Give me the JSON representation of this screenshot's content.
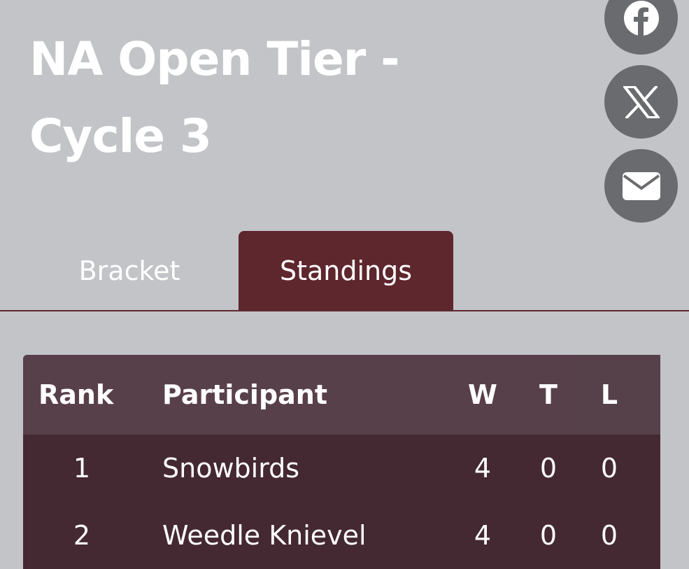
{
  "page": {
    "title": "NA Open Tier - Cycle 3"
  },
  "share": {
    "icons": [
      "facebook-icon",
      "x-icon",
      "email-icon"
    ]
  },
  "tabs": [
    {
      "label": "Bracket",
      "active": false
    },
    {
      "label": "Standings",
      "active": true
    }
  ],
  "standings": {
    "headers": {
      "rank": "Rank",
      "participant": "Participant",
      "w": "W",
      "t": "T",
      "l": "L"
    },
    "rows": [
      {
        "rank": "1",
        "participant": "Snowbirds",
        "w": "4",
        "t": "0",
        "l": "0"
      },
      {
        "rank": "2",
        "participant": "Weedle Knievel",
        "w": "4",
        "t": "0",
        "l": "0"
      }
    ]
  },
  "colors": {
    "background": "#c2c4c8",
    "accent": "#5e262d",
    "table_header": "#58404a",
    "table_body": "#442832",
    "share_button": "#6a6b6f"
  }
}
